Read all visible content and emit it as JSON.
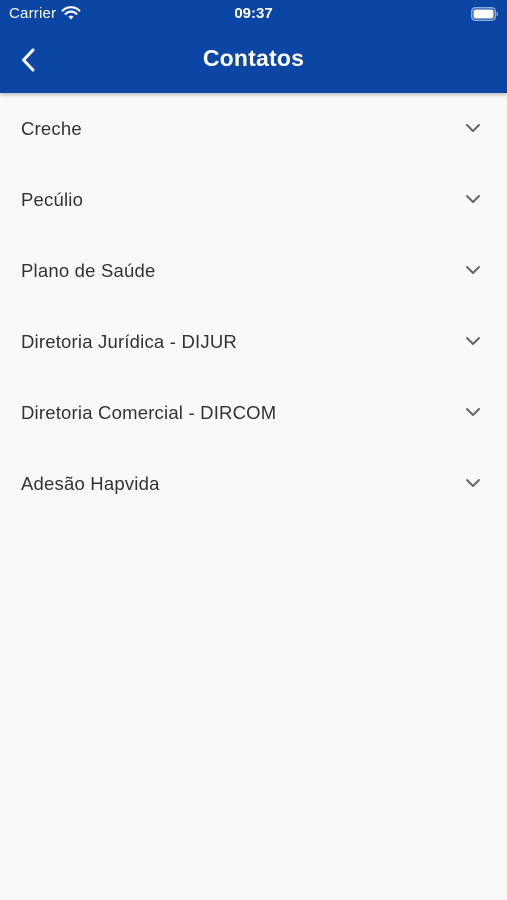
{
  "status_bar": {
    "carrier": "Carrier",
    "time": "09:37"
  },
  "header": {
    "title": "Contatos",
    "background_color": "#0b46a4",
    "back_icon": "chevron-left-icon"
  },
  "contacts": [
    {
      "label": "Creche"
    },
    {
      "label": "Pecúlio"
    },
    {
      "label": "Plano de Saúde"
    },
    {
      "label": "Diretoria Jurídica - DIJUR"
    },
    {
      "label": "Diretoria Comercial - DIRCOM"
    },
    {
      "label": "Adesão Hapvida"
    }
  ],
  "expand_icon": "chevron-down-icon",
  "page_background": "#f9f9f9"
}
